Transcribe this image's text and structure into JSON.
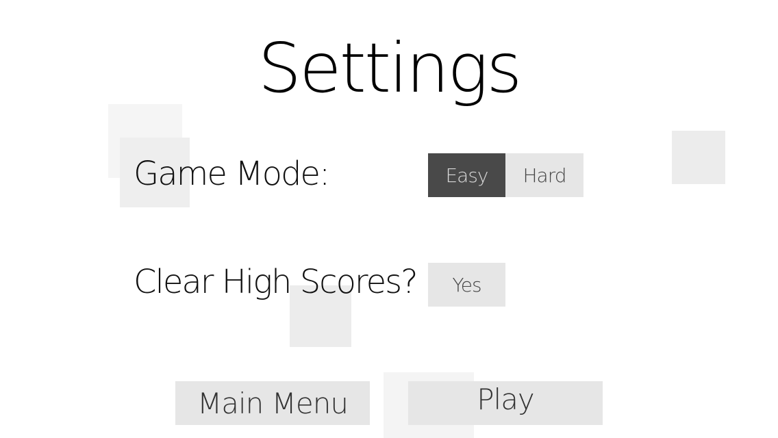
{
  "settings_screen": {
    "title": "Settings",
    "game_mode": {
      "label": "Game Mode:",
      "options": [
        "Easy",
        "Hard"
      ],
      "selected": "Easy"
    },
    "clear_high_scores": {
      "label": "Clear High Scores?",
      "button": "Yes"
    },
    "nav": {
      "main_menu": "Main Menu",
      "play": "Play"
    }
  },
  "colors": {
    "selected_bg": "#494949",
    "button_bg": "#e6e6e6",
    "background": "#ffffff"
  }
}
